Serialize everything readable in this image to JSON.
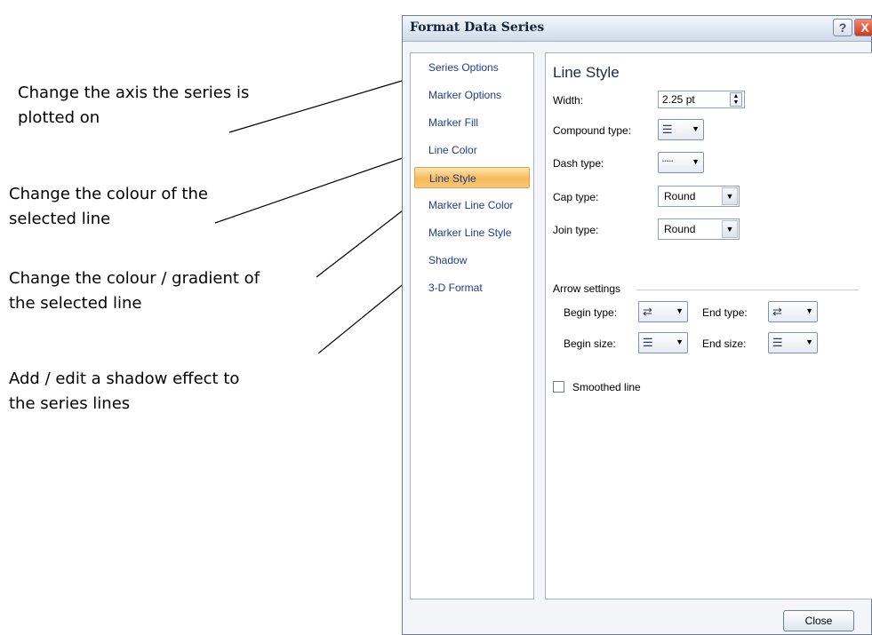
{
  "annotations": [
    {
      "text": "Change the axis the series is\nplotted on"
    },
    {
      "text": "Change the colour of the\nselected line"
    },
    {
      "text": "Change the colour / gradient of\nthe selected line"
    },
    {
      "text": "Add / edit a shadow effect to\nthe series lines"
    }
  ],
  "dialog": {
    "title": "Format Data Series",
    "help_label": "?",
    "close_x": "X",
    "nav": [
      "Series Options",
      "Marker Options",
      "Marker Fill",
      "Line Color",
      "Line Style",
      "Marker Line Color",
      "Marker Line Style",
      "Shadow",
      "3-D Format"
    ],
    "selected_nav": "Line Style",
    "heading": "Line Style",
    "width": {
      "label": "Width:",
      "value": "2.25 pt"
    },
    "compound_type": {
      "label": "Compound type:"
    },
    "dash_type": {
      "label": "Dash type:"
    },
    "cap_type": {
      "label": "Cap type:",
      "value": "Round"
    },
    "join_type": {
      "label": "Join type:",
      "value": "Round"
    },
    "arrow_settings": {
      "label": "Arrow settings",
      "begin_type": "Begin type:",
      "end_type": "End type:",
      "begin_size": "Begin size:",
      "end_size": "End size:"
    },
    "smoothed_line": {
      "label": "Smoothed line",
      "checked": false
    },
    "close_button": "Close"
  }
}
